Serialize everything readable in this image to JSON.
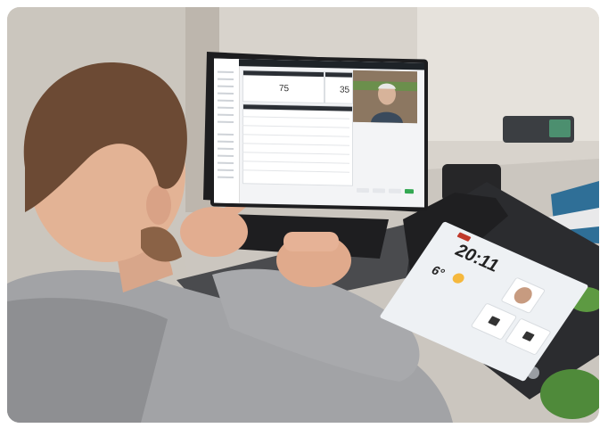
{
  "photo": {
    "subject": "",
    "colors": {
      "wall": "#d9d5cf",
      "desk": "#cfcac4",
      "jacket": "#a3a4a6",
      "hair": "#6b4a35",
      "skin": "#e7b79a",
      "laptop": "#3a3a3c",
      "phone": "#2d2d2f",
      "plant": "#4f8a3a"
    }
  },
  "laptop_screen": {
    "logo": "",
    "stats": [
      "75",
      "35"
    ]
  },
  "intercom_screen": {
    "time": "20:11",
    "temperature": "6°",
    "icons": [
      "sun-icon",
      "door-icon",
      "door-icon"
    ]
  }
}
